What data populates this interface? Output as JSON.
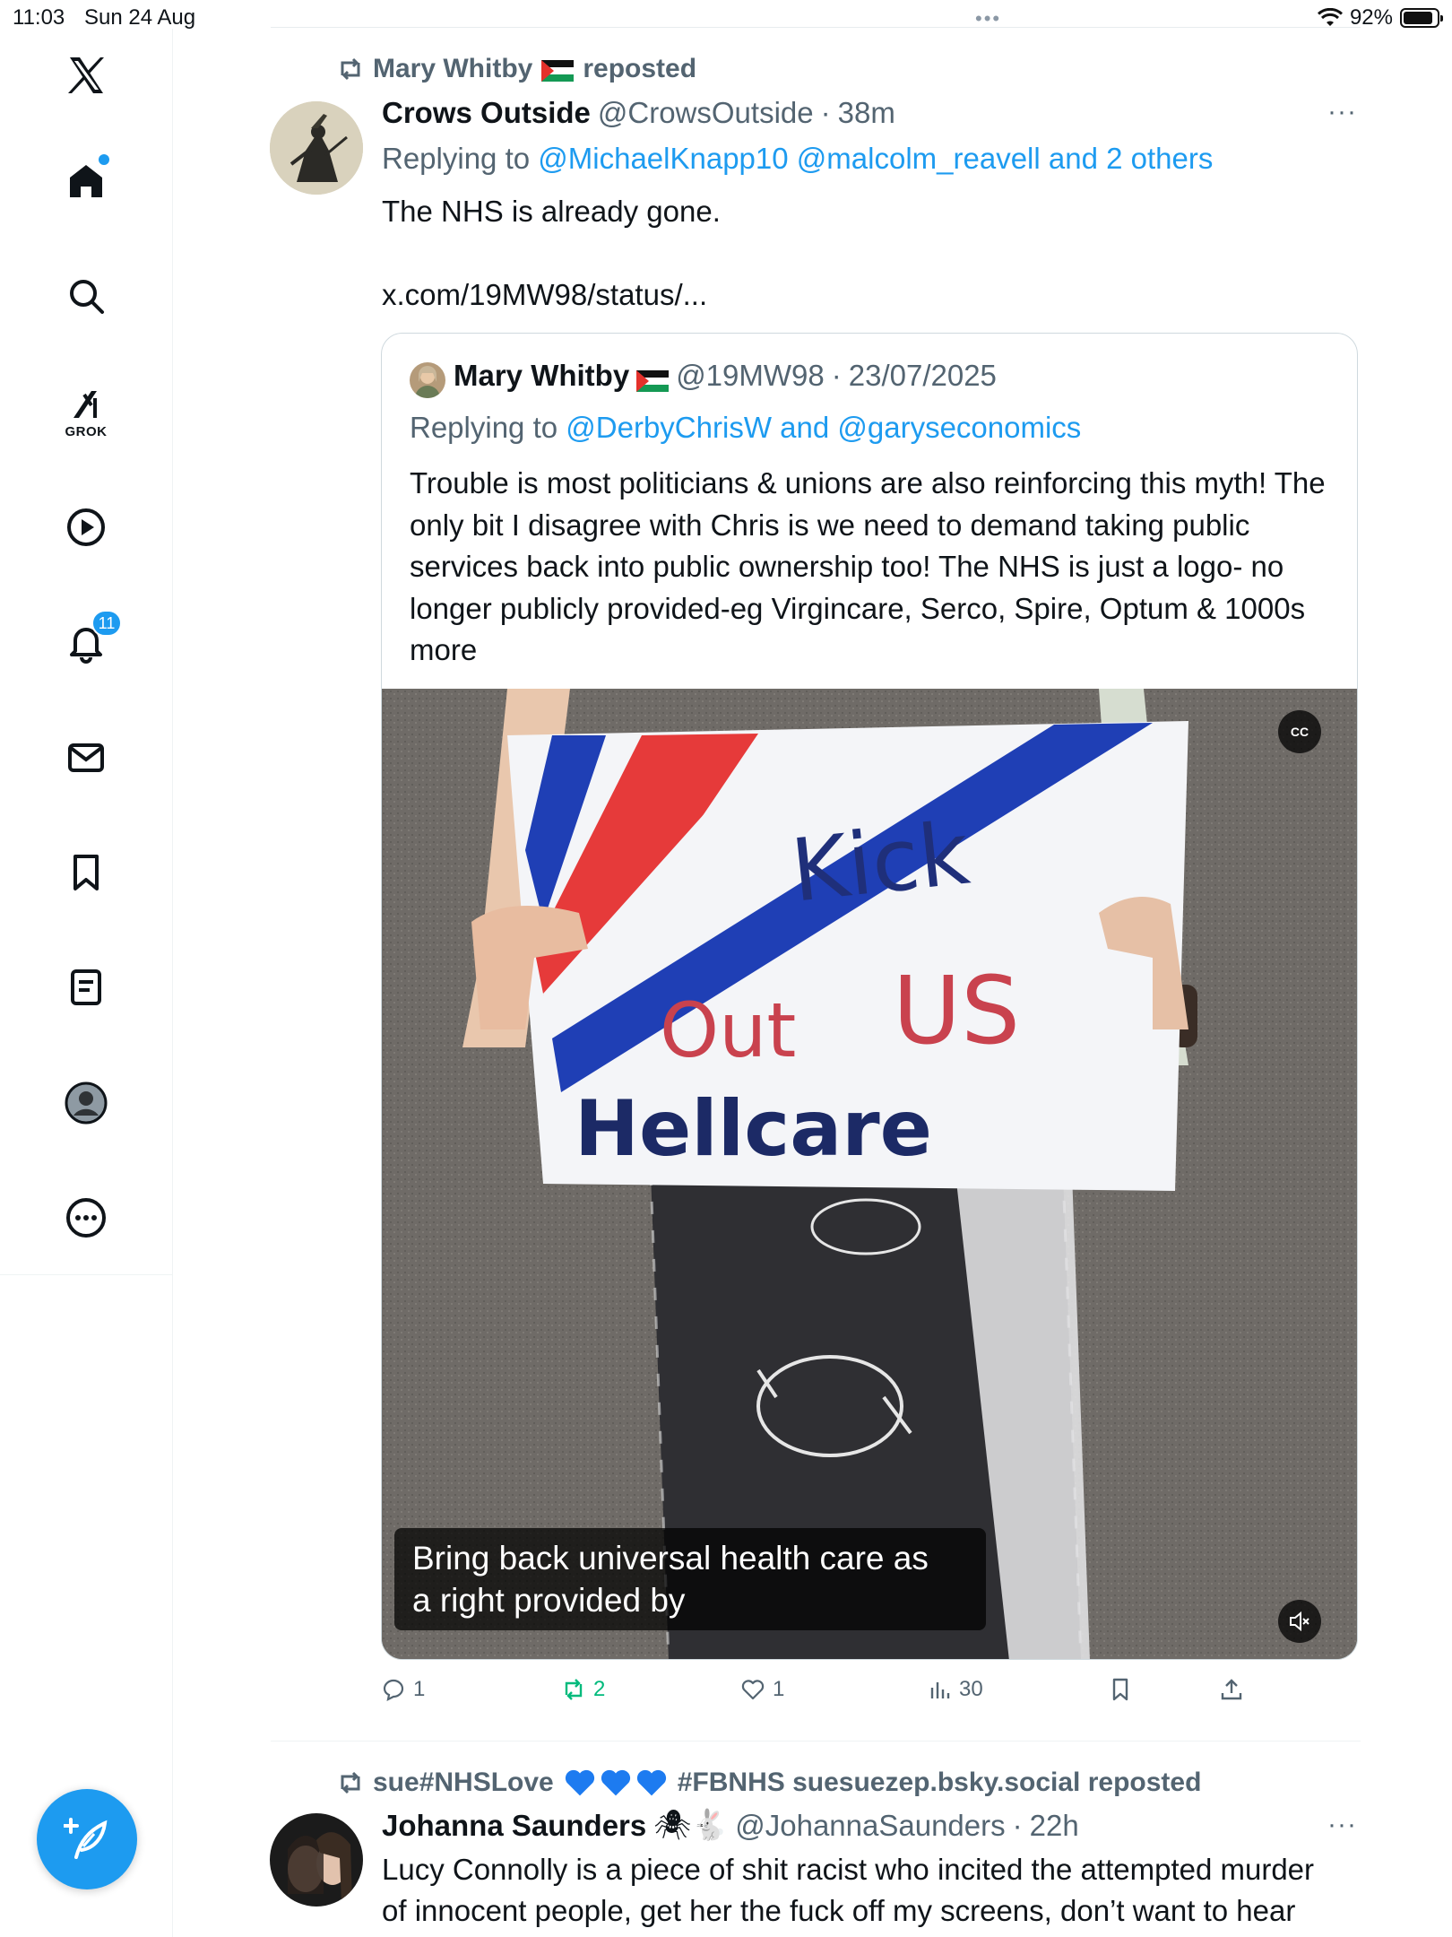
{
  "status": {
    "time": "11:03",
    "date": "Sun 24 Aug",
    "battery": "92%",
    "battery_level": 0.92
  },
  "sidebar": {
    "items": [
      {
        "name": "x-logo"
      },
      {
        "name": "home"
      },
      {
        "name": "search"
      },
      {
        "name": "grok",
        "label": "GROK"
      },
      {
        "name": "videos"
      },
      {
        "name": "notifications",
        "badge": "11"
      },
      {
        "name": "messages"
      },
      {
        "name": "bookmarks"
      },
      {
        "name": "lists"
      },
      {
        "name": "profile"
      },
      {
        "name": "more"
      }
    ]
  },
  "tweet1": {
    "reposted_by": "Mary Whitby",
    "reposted_suffix": "reposted",
    "author_name": "Crows Outside",
    "author_handle": "@CrowsOutside",
    "time": "38m",
    "more": "···",
    "replying_prefix": "Replying to",
    "replying_to_1": "@MichaelKnapp10",
    "replying_to_2": "@malcolm_reavell",
    "replying_to_and": "and 2 others",
    "text": "The NHS is already gone.",
    "link": "x.com/19MW98/status/...",
    "quote": {
      "author_name": "Mary Whitby",
      "author_handle": "@19MW98",
      "date": "23/07/2025",
      "replying_prefix": "Replying to",
      "replying_to_1": "@DerbyChrisW",
      "replying_and": "and",
      "replying_to_2": "@garyseconomics",
      "text": "Trouble is most politicians & unions are also reinforcing this myth! The only bit I disagree with Chris is we need to demand taking public services back into public ownership too! The NHS is just a logo- no longer publicly provided-eg Virgincare, Serco, Spire, Optum & 1000s more",
      "media": {
        "sign_line1": "Kick",
        "sign_line2a": "Out",
        "sign_line2b": "US",
        "sign_line3": "Hellcare",
        "cc_label": "CC",
        "caption_line1": "Bring back universal health care as",
        "caption_line2": "a right provided by"
      }
    },
    "actions": {
      "replies": "1",
      "reposts": "2",
      "likes": "1",
      "views": "30"
    }
  },
  "tweet2": {
    "reposted_by": "sue#NHSLove",
    "reposted_tail": "#FBNHS suesuezep.bsky.social reposted",
    "author_name": "Johanna Saunders",
    "author_emoji": "🕷🐇",
    "author_handle": "@JohannaSaunders",
    "time": "22h",
    "more": "···",
    "text_line1": "Lucy Connolly is a piece of shit racist who incited the attempted murder",
    "text_line2": "of innocent people, get her the fuck off my screens, don’t want to hear"
  },
  "colors": {
    "accent": "#1d9bf0",
    "repost_green": "#00ba7c",
    "muted": "#536471"
  }
}
